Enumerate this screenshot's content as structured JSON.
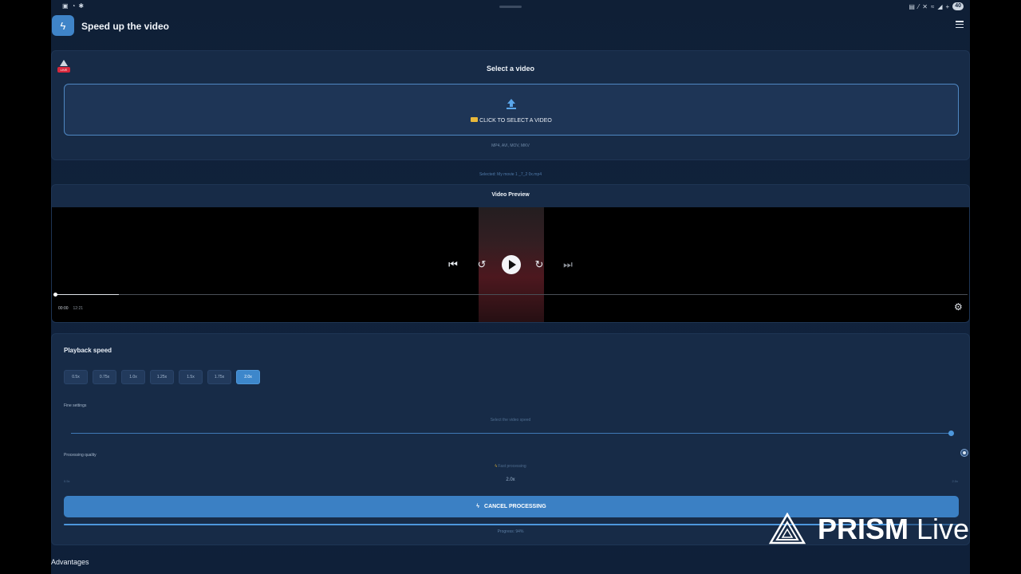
{
  "statusbar": {
    "battery": "40"
  },
  "header": {
    "title": "Speed up the video",
    "app_icon": "bolt-icon",
    "menu_icon": "hamburger-menu-icon"
  },
  "select_card": {
    "title": "Select a video",
    "dropzone_label": "CLICK TO SELECT A VIDEO",
    "formats": "MP4, AVI, MOV, MKV",
    "warning_badge": "LIVE"
  },
  "selected_file": "Selected: My movie 1 _7_2 0x.mp4",
  "preview": {
    "title": "Video Preview",
    "current_time": "00:00",
    "duration": "12:21",
    "seek_progress": 0.07
  },
  "speed": {
    "section_title": "Playback speed",
    "options": [
      "0.5x",
      "0.75x",
      "1.0x",
      "1.25x",
      "1.5x",
      "1.75x",
      "2.0x"
    ],
    "selected": "2.0x",
    "fine_label": "Fine settings",
    "slider_hint": "Select the video speed",
    "quality_label": "Processing quality",
    "fast_processing": "Fast processing",
    "range_min": "0.5x",
    "range_current": "2.0x",
    "range_max": "2.0x",
    "cancel_label": "CANCEL PROCESSING",
    "progress_text": "Progress: 94%",
    "progress_value": 0.94
  },
  "advantages_title": "Advantages",
  "watermark": {
    "text_bold": "PRISM",
    "text_light": " Live"
  },
  "colors": {
    "accent": "#3b80c4",
    "background": "#11233d",
    "card": "#172b47"
  }
}
